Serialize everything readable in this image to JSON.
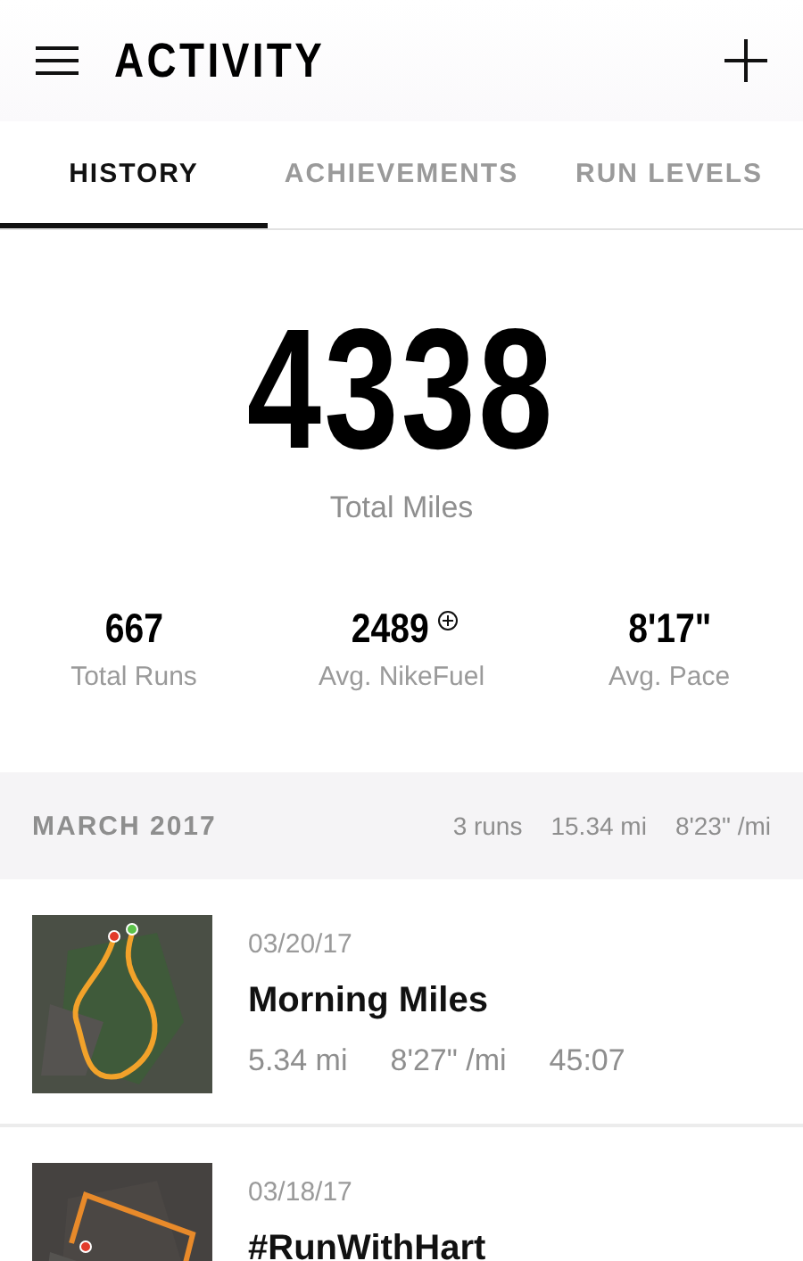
{
  "header": {
    "title": "ACTIVITY"
  },
  "tabs": [
    {
      "label": "HISTORY",
      "selected": true
    },
    {
      "label": "ACHIEVEMENTS",
      "selected": false
    },
    {
      "label": "RUN LEVELS",
      "selected": false
    }
  ],
  "total": {
    "value": "4338",
    "label": "Total Miles"
  },
  "stats": [
    {
      "value": "667",
      "label": "Total Runs",
      "fuel_icon": false
    },
    {
      "value": "2489",
      "label": "Avg. NikeFuel",
      "fuel_icon": true
    },
    {
      "value": "8'17\"",
      "label": "Avg. Pace",
      "fuel_icon": false
    }
  ],
  "month": {
    "title": "MARCH 2017",
    "runs": "3 runs",
    "distance": "15.34 mi",
    "pace": "8'23\" /mi"
  },
  "activities": [
    {
      "date": "03/20/17",
      "title": "Morning Miles",
      "distance": "5.34 mi",
      "pace": "8'27\" /mi",
      "duration": "45:07"
    },
    {
      "date": "03/18/17",
      "title": "#RunWithHart"
    }
  ]
}
